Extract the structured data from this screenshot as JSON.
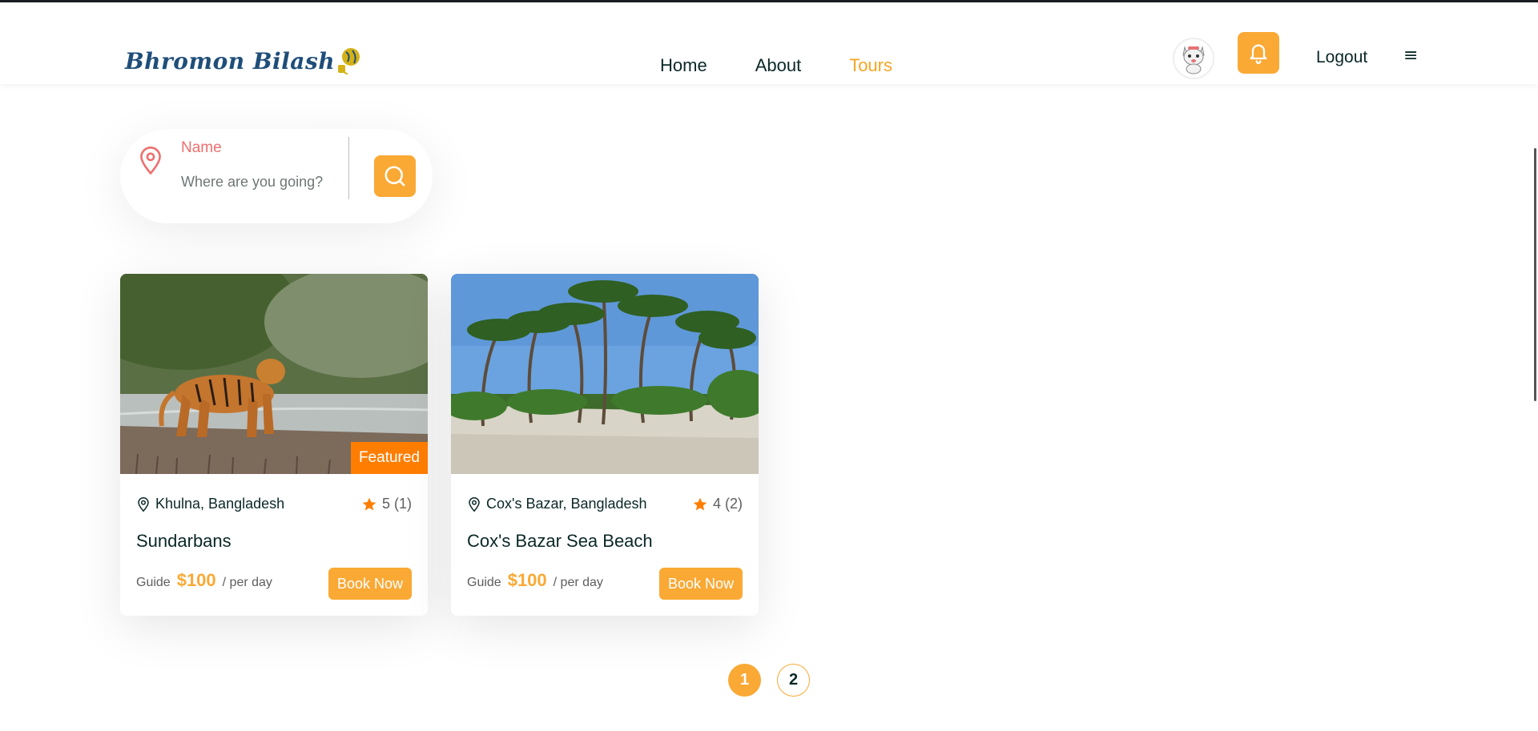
{
  "brand": {
    "logo_text": "Bhromon Bilash",
    "accent": "#faa935",
    "featured_color": "#ff7e01"
  },
  "nav": {
    "items": [
      {
        "label": "Home",
        "active": false
      },
      {
        "label": "About",
        "active": false
      },
      {
        "label": "Tours",
        "active": true
      }
    ]
  },
  "header_actions": {
    "avatar_icon": "cat-avatar-icon",
    "bell_icon": "bell-icon",
    "logout_label": "Logout",
    "menu_icon": "≡"
  },
  "search": {
    "label": "Name",
    "placeholder": "Where are you going?",
    "value": "",
    "location_icon": "map-pin-icon",
    "button_icon": "search-icon"
  },
  "tours": [
    {
      "image": "tiger-mangrove",
      "featured_label": "Featured",
      "location": "Khulna, Bangladesh",
      "rating": "5",
      "reviews": "(1)",
      "title": "Sundarbans",
      "guide_label": "Guide",
      "price": "$100",
      "per_label": "/ per day",
      "book_label": "Book Now"
    },
    {
      "image": "palm-beach",
      "featured_label": "",
      "location": "Cox's Bazar, Bangladesh",
      "rating": "4",
      "reviews": "(2)",
      "title": "Cox's Bazar Sea Beach",
      "guide_label": "Guide",
      "price": "$100",
      "per_label": "/ per day",
      "book_label": "Book Now"
    }
  ],
  "pagination": {
    "pages": [
      "1",
      "2"
    ],
    "current": "1"
  }
}
